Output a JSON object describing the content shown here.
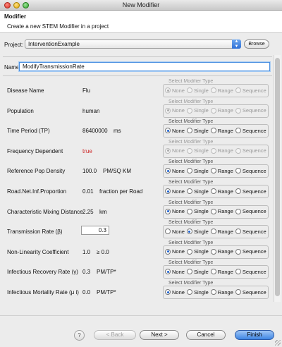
{
  "window": {
    "title": "New Modifier"
  },
  "header": {
    "title": "Modifier",
    "description": "Create a new STEM Modifier in a project"
  },
  "project": {
    "label": "Project:",
    "value": "InterventionExample",
    "browse_label": "Browse"
  },
  "name": {
    "label": "Name:",
    "value": "ModifyTransmissionRate"
  },
  "modifier_legend": "Select Modifier Type",
  "modifier_options": [
    "None",
    "Single",
    "Range",
    "Sequence"
  ],
  "parameters": [
    {
      "label": "Disease Name",
      "value": "Flu",
      "selected": "None",
      "enabled": false
    },
    {
      "label": "Population",
      "value": "human",
      "selected": "None",
      "enabled": false
    },
    {
      "label": "Time Period (TP)",
      "value": "86400000",
      "unit": "ms",
      "selected": "None",
      "enabled": true
    },
    {
      "label": "Frequency Dependent",
      "value": "true",
      "selected": "None",
      "enabled": false
    },
    {
      "label": "Reference Pop Density",
      "value": "100.0",
      "unit": "PM/SQ KM",
      "selected": "None",
      "enabled": true
    },
    {
      "label": "Road.Net.Inf.Proportion",
      "value": "0.01",
      "unit": "fraction per Road",
      "selected": "None",
      "enabled": true
    },
    {
      "label": "Characteristic Mixing Distance",
      "value": "2.25",
      "unit": "km",
      "selected": "None",
      "enabled": true
    },
    {
      "label": "Transmission Rate (β)",
      "value": "0.3",
      "unit": "",
      "selected": "Single",
      "enabled": true
    },
    {
      "label": "Non-Linearity Coefficient",
      "value": "1.0",
      "unit": "≥ 0.0",
      "selected": "None",
      "enabled": true
    },
    {
      "label": "Infectious Recovery Rate (γ)",
      "value": "0.3",
      "unit": "PM/TP*",
      "selected": "None",
      "enabled": true
    },
    {
      "label": "Infectious Mortality Rate (μ i)",
      "value": "0.0",
      "unit": "PM/TP*",
      "selected": "None",
      "enabled": true
    }
  ],
  "footer": {
    "help_label": "?",
    "back_label": "< Back",
    "next_label": "Next >",
    "cancel_label": "Cancel",
    "finish_label": "Finish"
  },
  "colors": {
    "accent": "#3f86e3",
    "true_value": "#cc2222"
  }
}
